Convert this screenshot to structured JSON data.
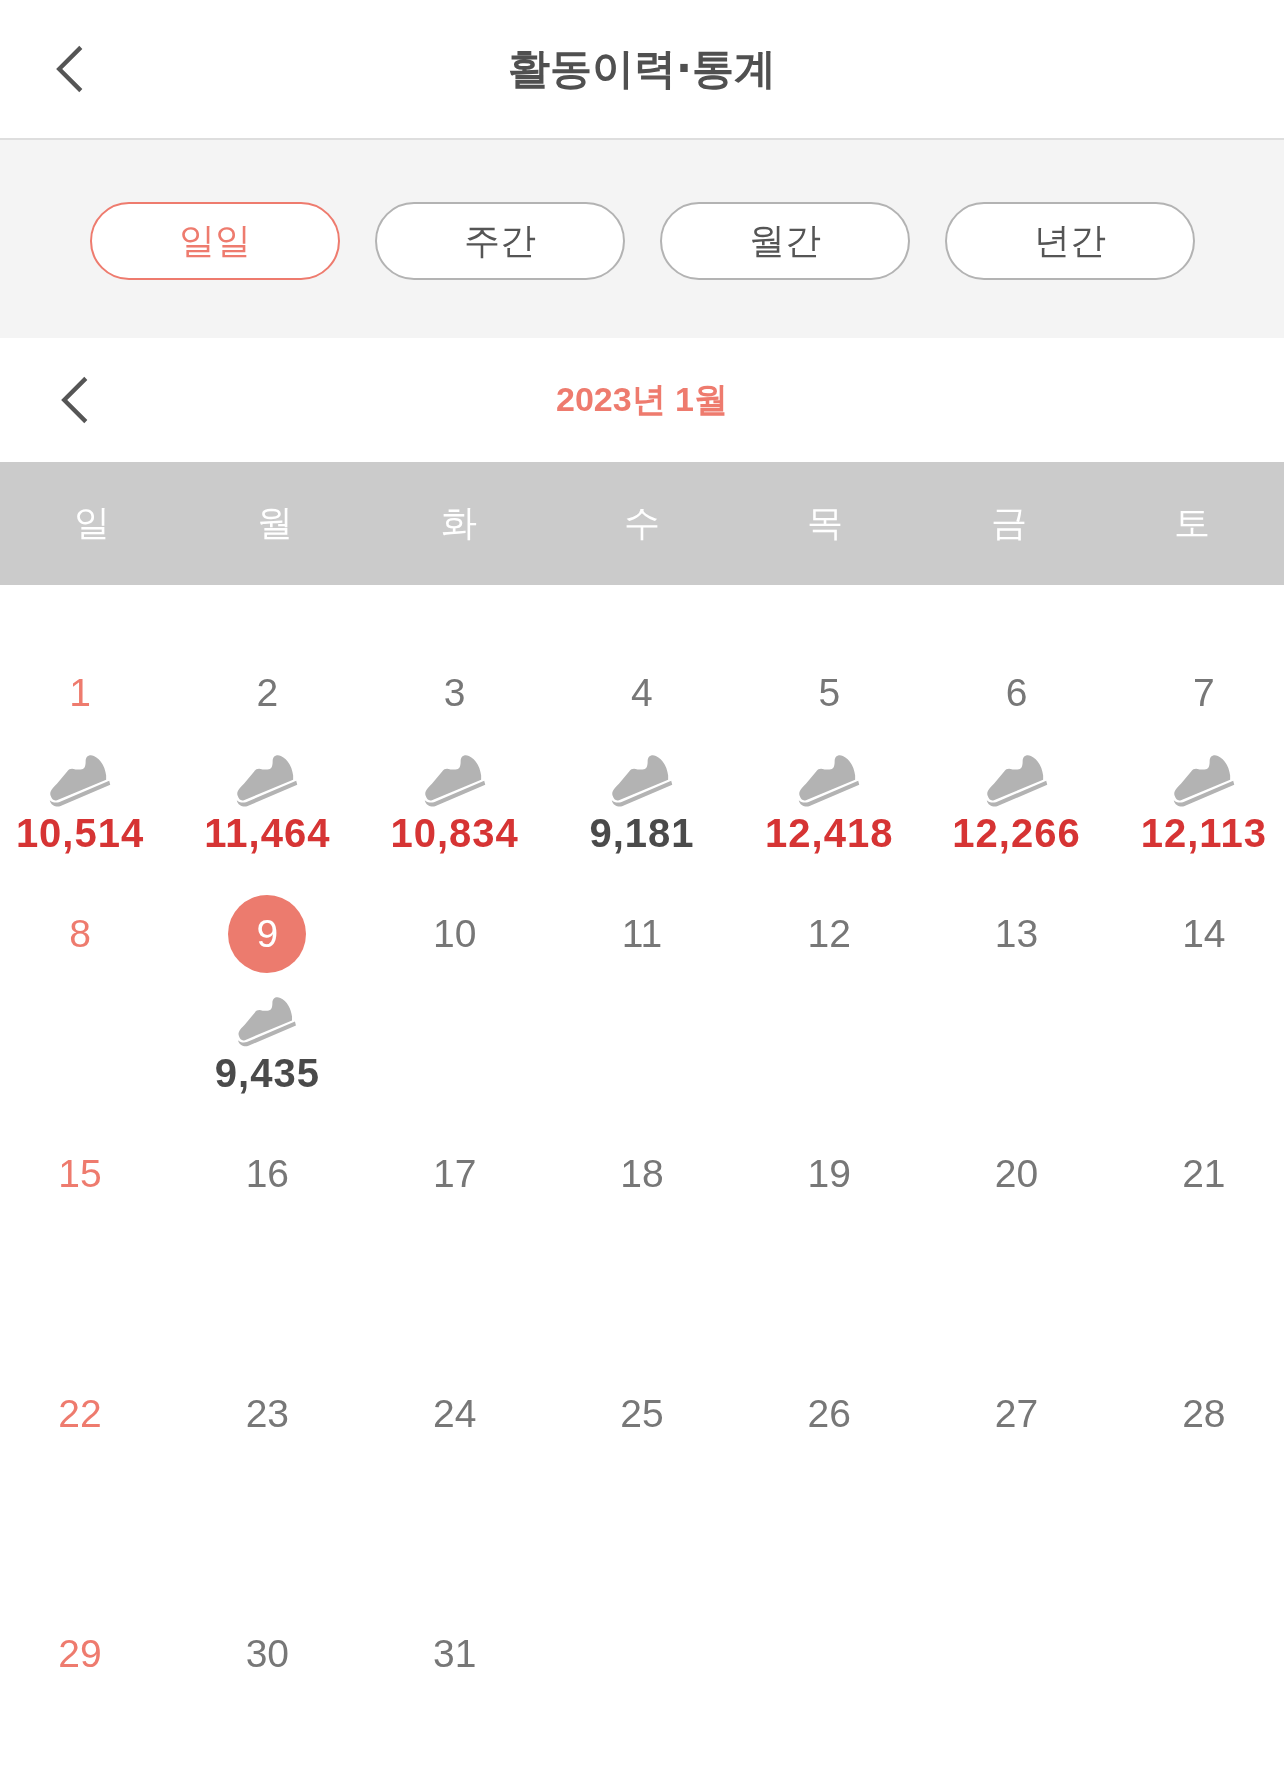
{
  "header": {
    "title": "활동이력·통계"
  },
  "period_tabs": [
    {
      "label": "일일",
      "selected": true
    },
    {
      "label": "주간",
      "selected": false
    },
    {
      "label": "월간",
      "selected": false
    },
    {
      "label": "년간",
      "selected": false
    }
  ],
  "month_nav": {
    "label": "2023년 1월"
  },
  "weekdays": [
    "일",
    "월",
    "화",
    "수",
    "목",
    "금",
    "토"
  ],
  "days": [
    {
      "date": "1",
      "kind": "sunday",
      "selected": false,
      "steps": "10,514",
      "goal_met": true
    },
    {
      "date": "2",
      "kind": "weekday",
      "selected": false,
      "steps": "11,464",
      "goal_met": true
    },
    {
      "date": "3",
      "kind": "weekday",
      "selected": false,
      "steps": "10,834",
      "goal_met": true
    },
    {
      "date": "4",
      "kind": "weekday",
      "selected": false,
      "steps": "9,181",
      "goal_met": false
    },
    {
      "date": "5",
      "kind": "weekday",
      "selected": false,
      "steps": "12,418",
      "goal_met": true
    },
    {
      "date": "6",
      "kind": "weekday",
      "selected": false,
      "steps": "12,266",
      "goal_met": true
    },
    {
      "date": "7",
      "kind": "weekday",
      "selected": false,
      "steps": "12,113",
      "goal_met": true
    },
    {
      "date": "8",
      "kind": "sunday",
      "selected": false
    },
    {
      "date": "9",
      "kind": "weekday",
      "selected": true,
      "steps": "9,435",
      "goal_met": false
    },
    {
      "date": "10",
      "kind": "weekday",
      "selected": false
    },
    {
      "date": "11",
      "kind": "weekday",
      "selected": false
    },
    {
      "date": "12",
      "kind": "weekday",
      "selected": false
    },
    {
      "date": "13",
      "kind": "weekday",
      "selected": false
    },
    {
      "date": "14",
      "kind": "weekday",
      "selected": false
    },
    {
      "date": "15",
      "kind": "sunday",
      "selected": false
    },
    {
      "date": "16",
      "kind": "weekday",
      "selected": false
    },
    {
      "date": "17",
      "kind": "weekday",
      "selected": false
    },
    {
      "date": "18",
      "kind": "weekday",
      "selected": false
    },
    {
      "date": "19",
      "kind": "weekday",
      "selected": false
    },
    {
      "date": "20",
      "kind": "weekday",
      "selected": false
    },
    {
      "date": "21",
      "kind": "weekday",
      "selected": false
    },
    {
      "date": "22",
      "kind": "sunday",
      "selected": false
    },
    {
      "date": "23",
      "kind": "weekday",
      "selected": false
    },
    {
      "date": "24",
      "kind": "weekday",
      "selected": false
    },
    {
      "date": "25",
      "kind": "weekday",
      "selected": false
    },
    {
      "date": "26",
      "kind": "weekday",
      "selected": false
    },
    {
      "date": "27",
      "kind": "weekday",
      "selected": false
    },
    {
      "date": "28",
      "kind": "weekday",
      "selected": false
    },
    {
      "date": "29",
      "kind": "sunday",
      "selected": false
    },
    {
      "date": "30",
      "kind": "weekday",
      "selected": false
    },
    {
      "date": "31",
      "kind": "weekday",
      "selected": false
    }
  ]
}
